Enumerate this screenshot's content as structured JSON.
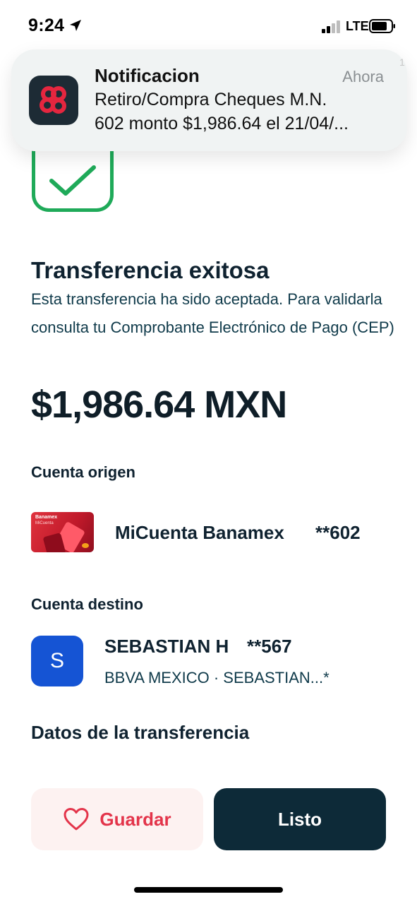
{
  "status_bar": {
    "time": "9:24",
    "network": "LTE"
  },
  "notification": {
    "title": "Notificacion",
    "time": "Ahora",
    "body_line1": "Retiro/Compra Cheques M.N.",
    "body_line2": "602 monto $1,986.64 el 21/04/...",
    "app_icon": "banamex-icon",
    "app_icon_color": "#e5263f"
  },
  "edge_mark": "1",
  "success": {
    "icon": "checkmark-icon",
    "color": "#1faa59",
    "title": "Transferencia exitosa",
    "description": "Esta transferencia ha sido aceptada. Para validarla consulta tu Comprobante Electrónico de Pago (CEP)"
  },
  "amount": "$1,986.64 MXN",
  "origin": {
    "label": "Cuenta origen",
    "card_brand": "Banamex",
    "card_sub": "MiCuenta",
    "account_name": "MiCuenta Banamex",
    "account_number": "**602"
  },
  "destination": {
    "label": "Cuenta destino",
    "avatar_letter": "S",
    "avatar_color": "#1554d4",
    "name": "SEBASTIAN H",
    "account_number": "**567",
    "bank_line": "BBVA MEXICO · SEBASTIAN...*"
  },
  "transfer_data": {
    "title": "Datos de la transferencia"
  },
  "actions": {
    "save_label": "Guardar",
    "save_icon": "heart-icon",
    "save_color": "#e3344a",
    "done_label": "Listo",
    "done_color": "#0d2a38"
  }
}
